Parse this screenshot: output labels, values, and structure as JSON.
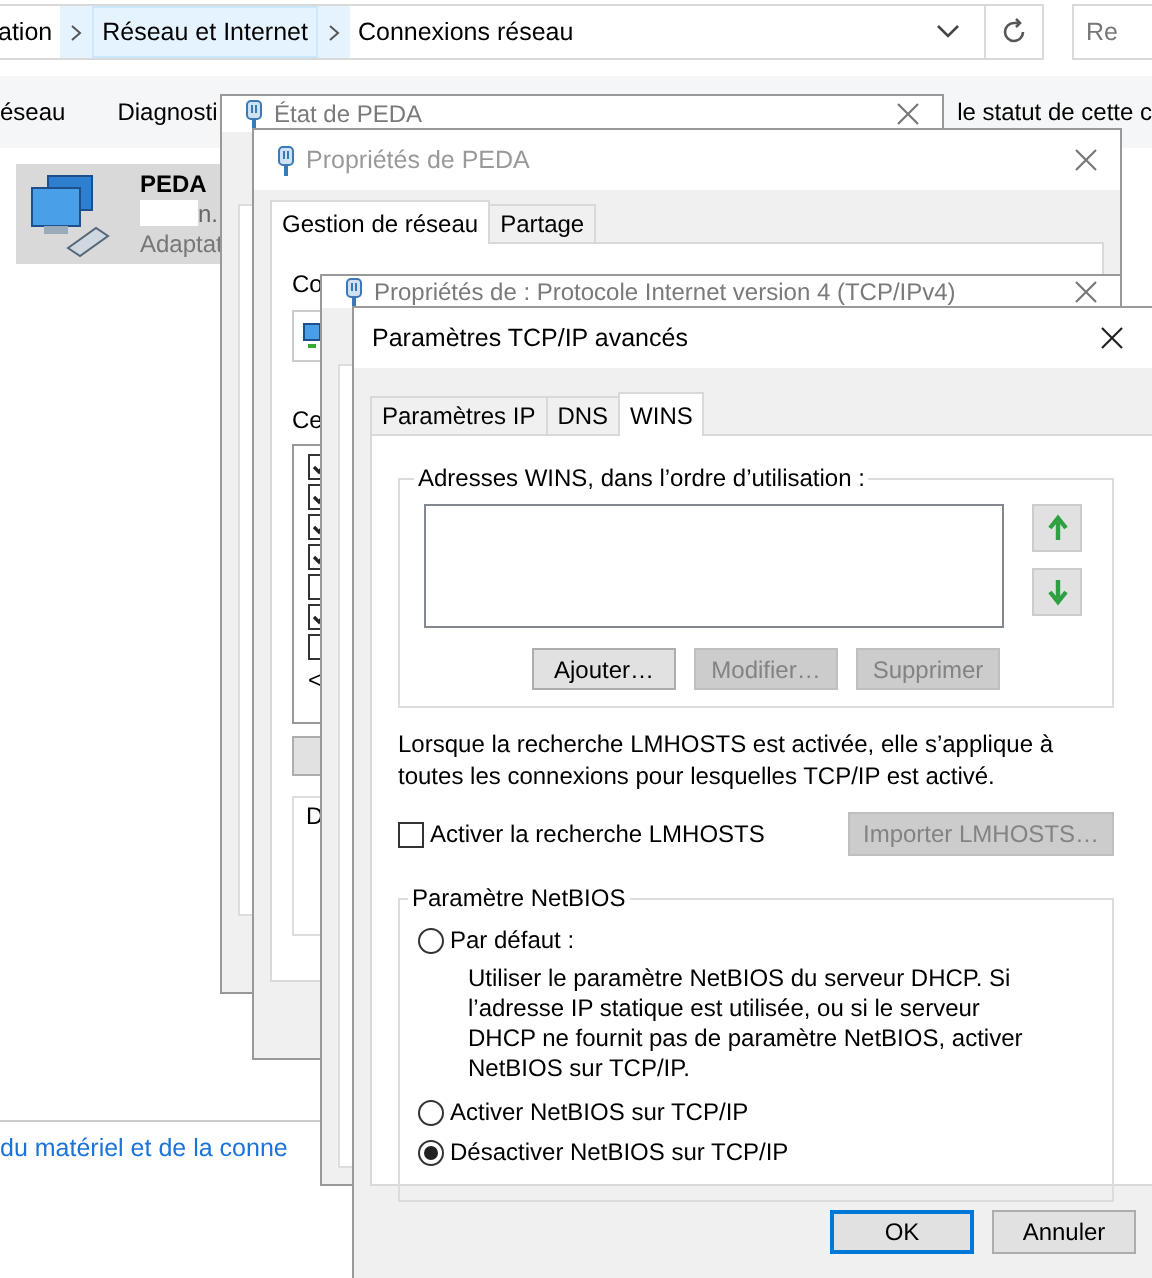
{
  "explorer": {
    "breadcrumb": [
      {
        "label": "ation",
        "selected": false
      },
      {
        "label": "Réseau et Internet",
        "selected": true
      },
      {
        "label": "Connexions réseau",
        "selected": false
      }
    ],
    "search": {
      "placeholder": "Re"
    },
    "toolbar": [
      "éseau",
      "Diagnosti",
      "le statut de cette c"
    ],
    "connection": {
      "name": "PEDA",
      "detail": "n.",
      "type": "Adaptat",
      "selected": true
    },
    "link": "du matériel et de la conne"
  },
  "status_window": {
    "title": "État de PEDA"
  },
  "properties_window": {
    "title": "Propriétés de PEDA",
    "tabs": [
      {
        "label": "Gestion de réseau",
        "selected": true
      },
      {
        "label": "Partage",
        "selected": false
      }
    ],
    "connection_label": "Co",
    "items_label": "Ce",
    "components": [
      {
        "checked": true
      },
      {
        "checked": true
      },
      {
        "checked": true
      },
      {
        "checked": true
      },
      {
        "checked": false
      },
      {
        "checked": true
      },
      {
        "checked": false
      }
    ],
    "scroll_arrow": "<",
    "description_label": "D"
  },
  "ipv4_window": {
    "title": "Propriétés de : Protocole Internet version 4 (TCP/IPv4)"
  },
  "advanced_window": {
    "title": "Paramètres TCP/IP avancés",
    "tabs": [
      {
        "label": "Paramètres IP",
        "selected": false
      },
      {
        "label": "DNS",
        "selected": false
      },
      {
        "label": "WINS",
        "selected": true
      }
    ],
    "wins_group": "Adresses WINS, dans l’ordre d’utilisation :",
    "wins_buttons": [
      {
        "label": "Ajouter…",
        "disabled": false
      },
      {
        "label": "Modifier…",
        "disabled": true
      },
      {
        "label": "Supprimer",
        "disabled": true
      }
    ],
    "lmhosts_note": "Lorsque la recherche LMHOSTS est activée, elle s’applique à toutes les connexions pour lesquelles TCP/IP est activé.",
    "lmhosts_checkbox": {
      "label": "Activer la recherche LMHOSTS",
      "checked": false
    },
    "import_button": {
      "label": "Importer LMHOSTS…",
      "disabled": true
    },
    "netbios_group": "Paramètre NetBIOS",
    "netbios_options": [
      {
        "label": "Par défaut :",
        "selected": false,
        "description": "Utiliser le paramètre NetBIOS du serveur DHCP. Si l’adresse IP statique est utilisée, ou si le serveur DHCP ne fournit pas de paramètre NetBIOS, activer NetBIOS sur TCP/IP."
      },
      {
        "label": "Activer NetBIOS sur TCP/IP",
        "selected": false
      },
      {
        "label": "Désactiver NetBIOS sur TCP/IP",
        "selected": true
      }
    ],
    "buttons": [
      {
        "label": "OK",
        "default": true
      },
      {
        "label": "Annuler",
        "default": false
      }
    ]
  }
}
